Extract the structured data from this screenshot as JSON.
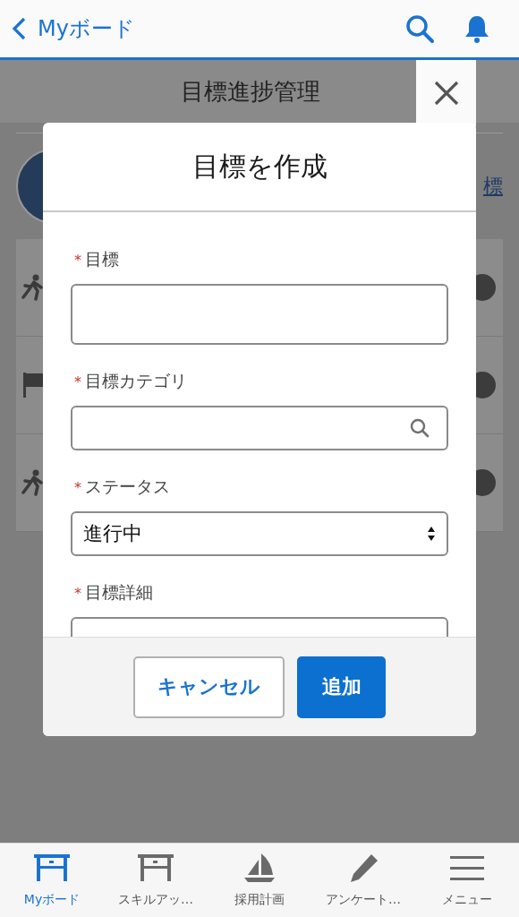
{
  "app_bar": {
    "back_label": "Myボード"
  },
  "page": {
    "title": "目標進捗管理",
    "link": "標",
    "rows": [
      {
        "kind": "runner"
      },
      {
        "kind": "flag"
      },
      {
        "kind": "runner"
      }
    ]
  },
  "modal": {
    "title": "目標を作成",
    "fields": [
      {
        "label": "目標",
        "required_mark": "*",
        "kind": "textarea"
      },
      {
        "label": "目標カテゴリ",
        "required_mark": "*",
        "kind": "lookup"
      },
      {
        "label": "ステータス",
        "required_mark": "*",
        "kind": "select",
        "value": "進行中"
      },
      {
        "label": "目標詳細",
        "required_mark": "*",
        "kind": "textarea"
      }
    ],
    "buttons": [
      {
        "label": "キャンセル",
        "kind": "neutral"
      },
      {
        "label": "追加",
        "kind": "brand"
      }
    ]
  },
  "tab_bar": [
    {
      "label": "Myボード",
      "kind": "desk",
      "selected": true
    },
    {
      "label": "スキルアッ…",
      "kind": "desk",
      "selected": false
    },
    {
      "label": "採用計画",
      "kind": "sailboat",
      "selected": false
    },
    {
      "label": "アンケート…",
      "kind": "pencil",
      "selected": false
    },
    {
      "label": "メニュー",
      "kind": "menu",
      "selected": false
    }
  ]
}
